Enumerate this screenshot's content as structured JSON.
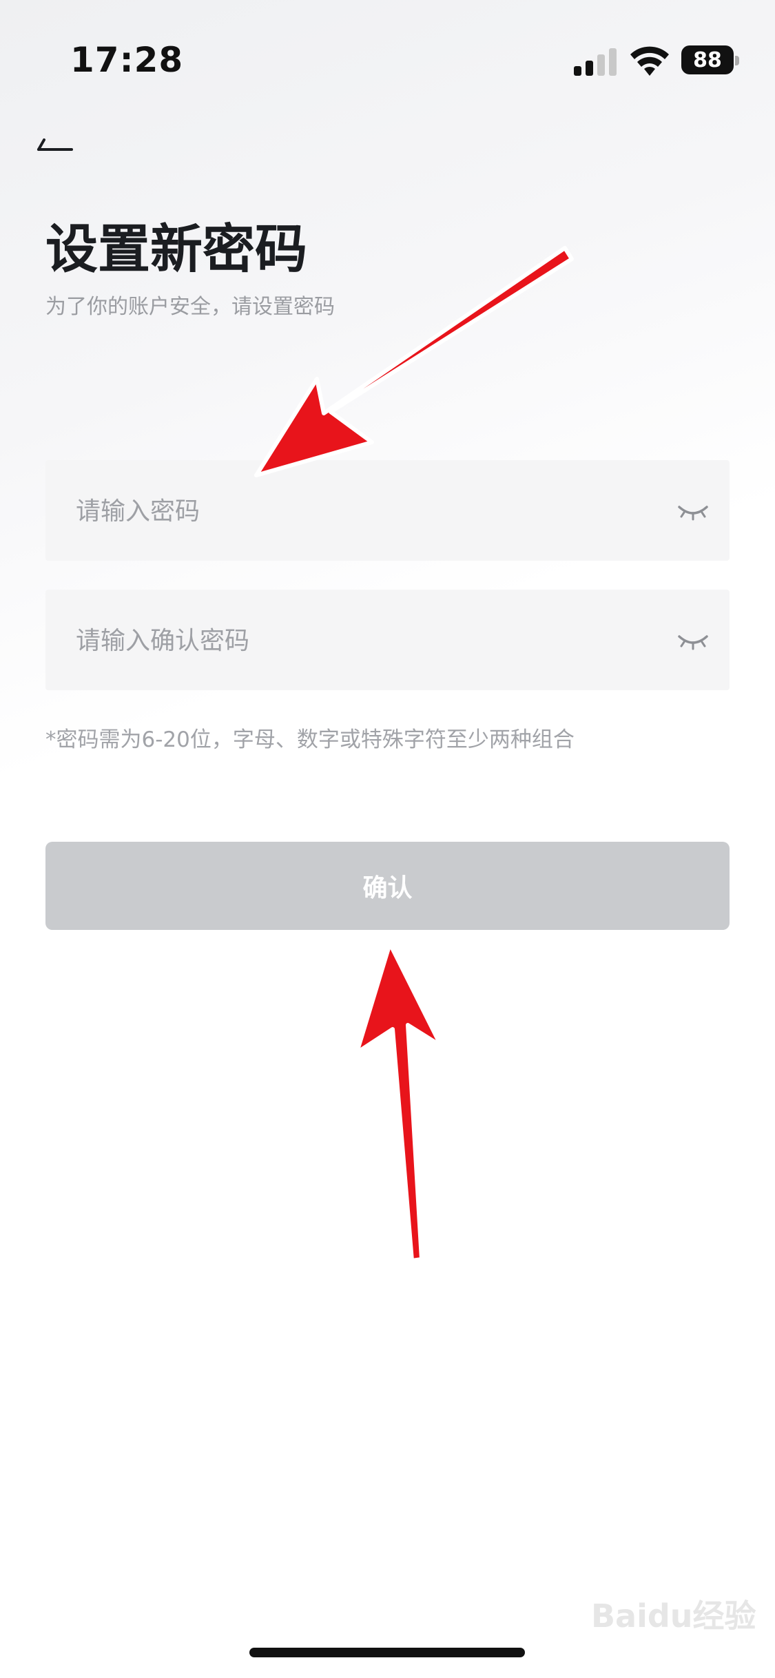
{
  "status_bar": {
    "time": "17:28",
    "battery": "88"
  },
  "header": {
    "back_icon": "back-arrow-icon",
    "title": "设置新密码",
    "subtitle": "为了你的账户安全，请设置密码"
  },
  "form": {
    "password_placeholder": "请输入密码",
    "confirm_placeholder": "请输入确认密码",
    "eye_icon": "eye-closed-icon",
    "hint": "*密码需为6-20位，字母、数字或特殊字符至少两种组合"
  },
  "actions": {
    "confirm_label": "确认"
  },
  "watermark": "Baidu经验",
  "colors": {
    "title": "#1b1d21",
    "muted": "#9a9ca1",
    "field_bg": "#f5f5f6",
    "button_disabled": "#c9cbce",
    "annotation_arrow": "#e8141b"
  }
}
